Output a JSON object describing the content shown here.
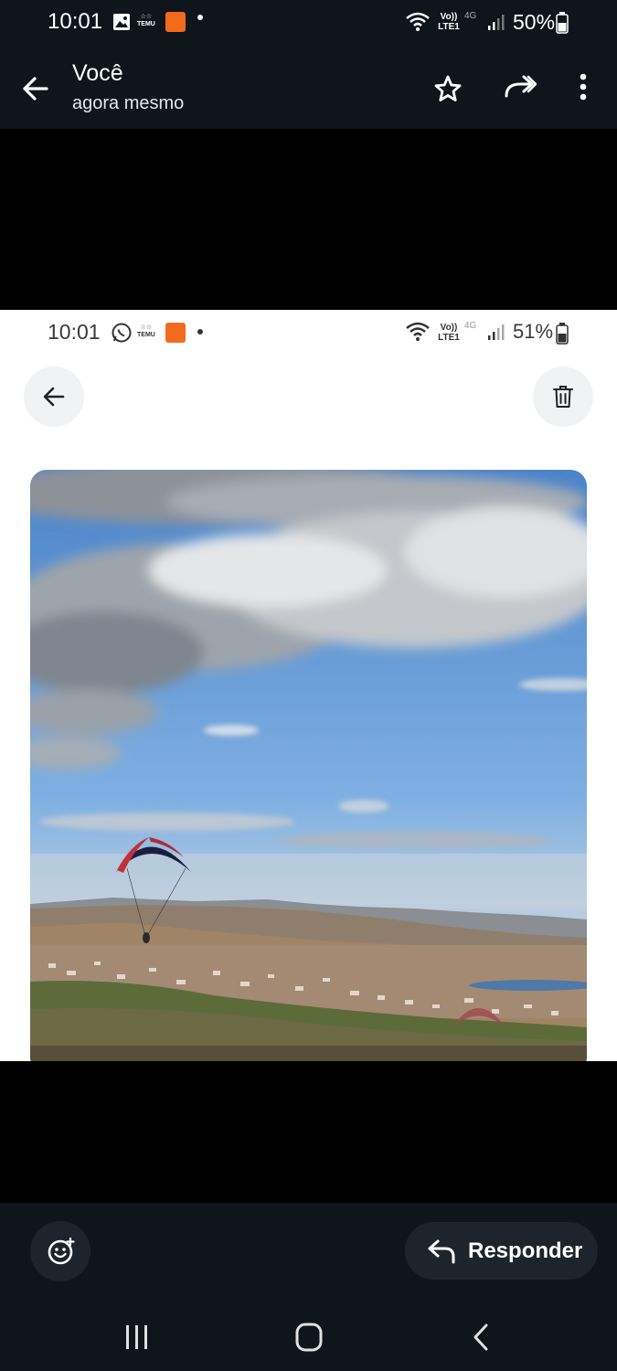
{
  "status_bar": {
    "time": "10:01",
    "temu_label": "TEMU",
    "network": "Vo)) LTE1",
    "network_gen": "4G",
    "battery": "50%"
  },
  "header": {
    "title": "Você",
    "subtitle": "agora mesmo",
    "icons": [
      "back-arrow-icon",
      "star-icon",
      "forward-icon",
      "more-vertical-icon"
    ]
  },
  "inner_screenshot": {
    "status_bar": {
      "time": "10:01",
      "temu_label": "TEMU",
      "network": "Vo)) LTE1",
      "network_gen": "4G",
      "battery": "51%"
    },
    "icons": [
      "back-arrow-icon",
      "trash-icon"
    ]
  },
  "footer": {
    "reply_label": "Responder",
    "icons": [
      "emoji-add-icon",
      "reply-icon"
    ]
  },
  "nav_bar": {
    "icons": [
      "recents-icon",
      "home-icon",
      "back-icon"
    ]
  },
  "colors": {
    "dark_bg": "#0f151b",
    "button_bg": "#1d242b",
    "inner_bg": "#ffffff",
    "temu_orange": "#f26b1d"
  }
}
